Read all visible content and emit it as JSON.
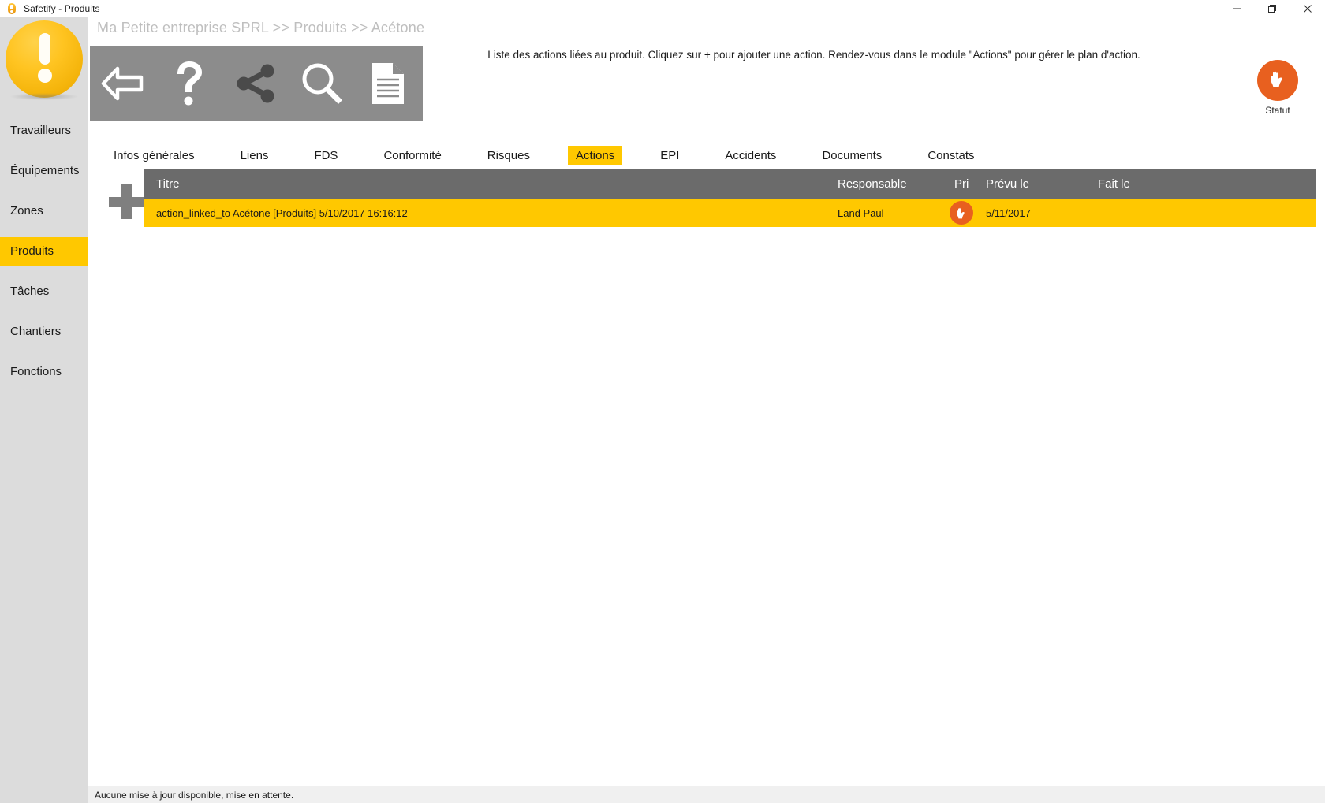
{
  "window": {
    "title": "Safetify - Produits",
    "app_icon": "exclamation-badge-icon",
    "controls": {
      "minimize": "minimize-icon",
      "maximize": "maximize-icon",
      "close": "close-icon"
    }
  },
  "sidebar": {
    "logo": "safetify-logo",
    "items": [
      {
        "label": "Travailleurs",
        "active": false
      },
      {
        "label": "Équipements",
        "active": false
      },
      {
        "label": "Zones",
        "active": false
      },
      {
        "label": "Produits",
        "active": true
      },
      {
        "label": "Tâches",
        "active": false
      },
      {
        "label": "Chantiers",
        "active": false
      },
      {
        "label": "Fonctions",
        "active": false
      }
    ]
  },
  "breadcrumb": "Ma Petite entreprise SPRL >> Produits >> Acétone",
  "toolbar": {
    "buttons": [
      {
        "name": "back-arrow-icon",
        "label": "Retour"
      },
      {
        "name": "help-question-icon",
        "label": "Aide"
      },
      {
        "name": "share-icon",
        "label": "Partager"
      },
      {
        "name": "search-magnifier-icon",
        "label": "Rechercher"
      },
      {
        "name": "document-icon",
        "label": "Document"
      }
    ]
  },
  "hint": "Liste des actions liées au produit. Cliquez sur + pour ajouter une action. Rendez-vous dans le module \"Actions\" pour gérer le plan d'action.",
  "statut": {
    "label": "Statut",
    "icon": "hand-stop-icon",
    "color": "#e8601f"
  },
  "tabs": [
    {
      "label": "Infos générales",
      "active": false
    },
    {
      "label": "Liens",
      "active": false
    },
    {
      "label": "FDS",
      "active": false
    },
    {
      "label": "Conformité",
      "active": false
    },
    {
      "label": "Risques",
      "active": false
    },
    {
      "label": "Actions",
      "active": true
    },
    {
      "label": "EPI",
      "active": false
    },
    {
      "label": "Accidents",
      "active": false
    },
    {
      "label": "Documents",
      "active": false
    },
    {
      "label": "Constats",
      "active": false
    }
  ],
  "add_button": {
    "name": "add-plus-icon",
    "label": "+"
  },
  "table": {
    "columns": [
      "Titre",
      "Responsable",
      "Pri",
      "Prévu le",
      "Fait le"
    ],
    "rows": [
      {
        "titre": "action_linked_to Acétone [Produits]  5/10/2017 16:16:12",
        "responsable": "Land Paul",
        "priorite_icon": "hand-stop-icon",
        "prevu_le": "5/11/2017",
        "fait_le": ""
      }
    ]
  },
  "statusbar": {
    "message": "Aucune mise à jour disponible, mise en attente."
  },
  "colors": {
    "accent_yellow": "#ffc800",
    "orange": "#e8601f",
    "toolbar_gray": "#8c8c8c",
    "header_gray": "#6b6b6b",
    "sidebar_gray": "#dcdcdc"
  }
}
